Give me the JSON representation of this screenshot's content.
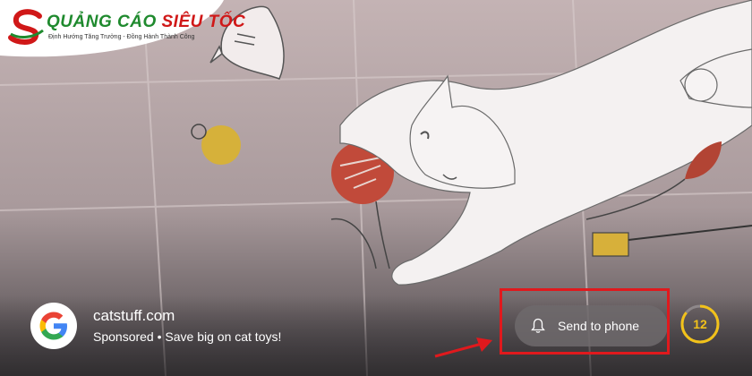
{
  "logo": {
    "brand_part1": "QUẢNG CÁO ",
    "brand_part2": "SIÊU TỐC",
    "tagline": "Định Hướng Tăng Trưởng - Đồng Hành Thành Công"
  },
  "ad": {
    "domain": "catstuff.com",
    "sponsored_label": "Sponsored",
    "separator": "•",
    "description": "Save big on cat toys!"
  },
  "actions": {
    "send_to_phone_label": "Send to phone"
  },
  "timer": {
    "countdown": "12",
    "color": "#f2c21a"
  },
  "colors": {
    "highlight": "#e0191d",
    "brand_green": "#1f8a2e",
    "brand_red": "#d01818"
  },
  "icons": {
    "google": "google-logo-icon",
    "bell": "bell-icon",
    "arrow": "red-arrow-icon"
  }
}
